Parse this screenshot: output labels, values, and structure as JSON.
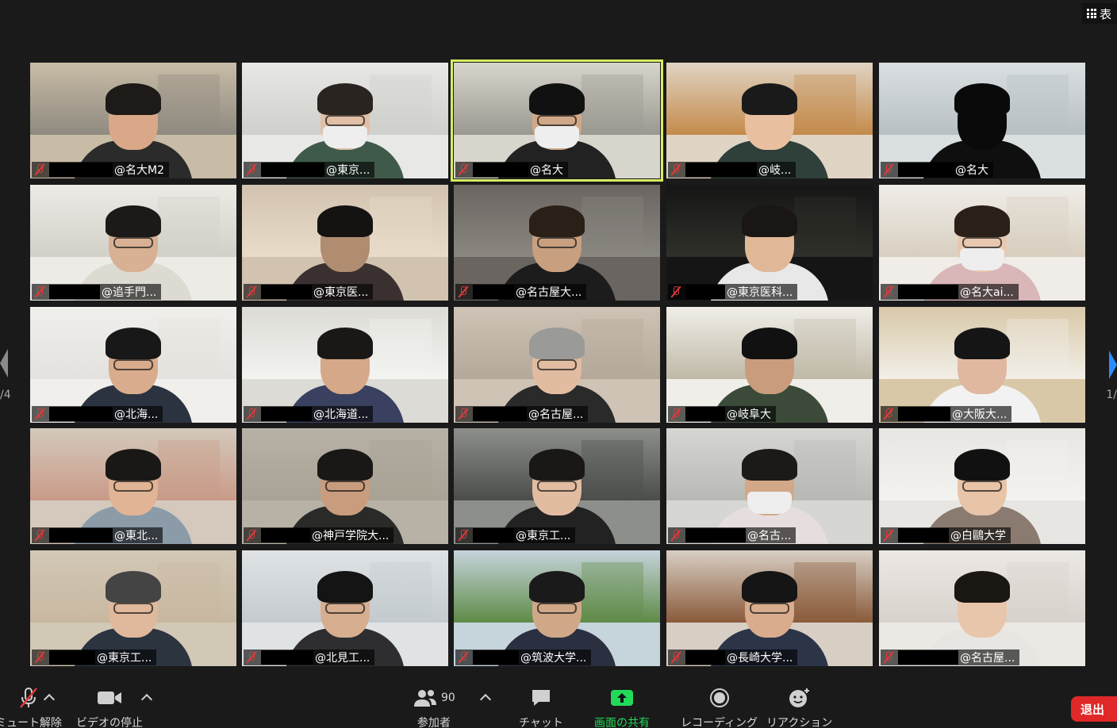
{
  "view": {
    "label": "表"
  },
  "participants": [
    {
      "name": "@名大M2",
      "scene": [
        "#c8bca6",
        "#8f8a80",
        "#2b2b2b",
        "#d8a888",
        "#1e1a18"
      ],
      "glasses": false,
      "mask": false
    },
    {
      "name": "@東京...",
      "scene": [
        "#e8e8e6",
        "#cfcfcb",
        "#3f5a4a",
        "#e0bfa6",
        "#2a2420"
      ],
      "glasses": true,
      "mask": true
    },
    {
      "name": "@名大",
      "scene": [
        "#d8d6cc",
        "#9a9890",
        "#222222",
        "#d0a888",
        "#111111"
      ],
      "glasses": true,
      "mask": true
    },
    {
      "name": "@岐...",
      "scene": [
        "#e0d4c4",
        "#c48a4a",
        "#2f3f3a",
        "#e8c0a0",
        "#1a1a1a"
      ],
      "glasses": false,
      "mask": false
    },
    {
      "name": "@名大",
      "scene": [
        "#dadfe2",
        "#b8c0c4",
        "#0f0f0f",
        "#0a0a0a",
        "#0a0a0a"
      ],
      "glasses": false,
      "mask": false
    },
    {
      "name": "@追手門...",
      "scene": [
        "#ecebe6",
        "#d2d0c8",
        "#dddad2",
        "#d8b094",
        "#1c1a18"
      ],
      "glasses": true,
      "mask": false
    },
    {
      "name": "@東京医...",
      "scene": [
        "#d2c3b0",
        "#e8dcc8",
        "#3a3030",
        "#b08c70",
        "#151212"
      ],
      "glasses": false,
      "mask": false
    },
    {
      "name": "@名古屋大...",
      "scene": [
        "#6a6560",
        "#8a8680",
        "#1c1c1c",
        "#c8a080",
        "#2a2018"
      ],
      "glasses": true,
      "mask": false
    },
    {
      "name": "@東京医科...",
      "scene": [
        "#151515",
        "#30302a",
        "#e8e8e8",
        "#e0b898",
        "#1a1614"
      ],
      "glasses": false,
      "mask": false
    },
    {
      "name": "@名大ai...",
      "scene": [
        "#f0ede8",
        "#d8cfc0",
        "#d9b6b8",
        "#e8c8b0",
        "#2a2018"
      ],
      "glasses": true,
      "mask": true
    },
    {
      "name": "@北海...",
      "scene": [
        "#f0efeb",
        "#e4e2de",
        "#2c3340",
        "#d8ac8c",
        "#181818"
      ],
      "glasses": true,
      "mask": false
    },
    {
      "name": "@北海道...",
      "scene": [
        "#dcdbd6",
        "#f3f3f0",
        "#3a4060",
        "#d4a888",
        "#1a1816"
      ],
      "glasses": false,
      "mask": false
    },
    {
      "name": "@名古屋...",
      "scene": [
        "#cfc3b6",
        "#b4a89a",
        "#2a2a2a",
        "#e2bca0",
        "#9a9a98"
      ],
      "glasses": true,
      "mask": false
    },
    {
      "name": "@岐阜大",
      "scene": [
        "#f0eee8",
        "#c0b9a8",
        "#3c4a3a",
        "#c89c7c",
        "#111111"
      ],
      "glasses": false,
      "mask": false
    },
    {
      "name": "@大阪大...",
      "scene": [
        "#d8c8a8",
        "#f2efe8",
        "#f2f2f2",
        "#e0b8a0",
        "#151515"
      ],
      "glasses": false,
      "mask": false
    },
    {
      "name": "@東北...",
      "scene": [
        "#d4c9bc",
        "#c99a88",
        "#8c9ba8",
        "#e0b494",
        "#1a1816"
      ],
      "glasses": true,
      "mask": false
    },
    {
      "name": "@神戸学院大...",
      "scene": [
        "#b7b1a6",
        "#a9a296",
        "#2a2a28",
        "#c89c7c",
        "#1a1816"
      ],
      "glasses": true,
      "mask": false
    },
    {
      "name": "@東京工...",
      "scene": [
        "#8c8f8a",
        "#4a4d4a",
        "#222222",
        "#e2bca0",
        "#1a1816"
      ],
      "glasses": true,
      "mask": false
    },
    {
      "name": "@名古...",
      "scene": [
        "#d6d6d2",
        "#b8b8b4",
        "#e6dede",
        "#d2a888",
        "#1c1a18"
      ],
      "glasses": false,
      "mask": true
    },
    {
      "name": "@白鷗大学",
      "scene": [
        "#e8e6e2",
        "#f4f2ee",
        "#8a7a70",
        "#e8c4a8",
        "#111111"
      ],
      "glasses": true,
      "mask": false
    },
    {
      "name": "@東京工...",
      "scene": [
        "#d2c8b6",
        "#c8b8a0",
        "#2c3440",
        "#e0b89c",
        "#444444"
      ],
      "glasses": true,
      "mask": false
    },
    {
      "name": "@北見工...",
      "scene": [
        "#dfe3e6",
        "#c4cace",
        "#2e2e30",
        "#d8ae90",
        "#141414"
      ],
      "glasses": true,
      "mask": false
    },
    {
      "name": "@筑波大学...",
      "scene": [
        "#c6d4dc",
        "#5e8a46",
        "#2a3040",
        "#d0a888",
        "#1a1a1a"
      ],
      "glasses": true,
      "mask": false
    },
    {
      "name": "@長崎大学...",
      "scene": [
        "#d8cfc4",
        "#8a5a3a",
        "#2c3448",
        "#d8ac8c",
        "#151515"
      ],
      "glasses": true,
      "mask": false
    },
    {
      "name": "@名古屋...",
      "scene": [
        "#ece8e4",
        "#d8d2cc",
        "#e8e6e2",
        "#e8c6ac",
        "#1a1612"
      ],
      "glasses": false,
      "mask": false
    }
  ],
  "pagination": {
    "left": "/4",
    "right": "1/"
  },
  "toolbar": {
    "unmute_label": "ミュート解除",
    "video_label": "ビデオの停止",
    "participants_label": "参加者",
    "participants_count": "90",
    "chat_label": "チャット",
    "share_label": "画面の共有",
    "record_label": "レコーディング",
    "reaction_label": "リアクション",
    "leave_label": "退出",
    "share_color": "#23d959",
    "leave_color": "#e02828"
  }
}
